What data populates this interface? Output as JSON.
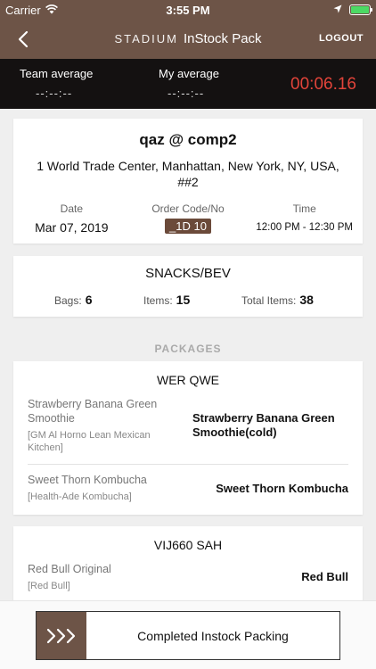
{
  "status_bar": {
    "carrier": "Carrier",
    "time": "3:55 PM"
  },
  "nav": {
    "brand": "STADIUM",
    "title": "InStock Pack",
    "logout_label": "LOGOUT"
  },
  "timers": {
    "team_label": "Team average",
    "team_value": "--:--:--",
    "my_label": "My average",
    "my_value": "--:--:--",
    "elapsed": "00:06.16",
    "elapsed_color": "#e2443a"
  },
  "order": {
    "title": "qaz @ comp2",
    "address": "1 World Trade Center, Manhattan, New York, NY, USA, ##2",
    "date_label": "Date",
    "date_value": "Mar 07, 2019",
    "code_label": "Order Code/No",
    "code_value": "_1D 10",
    "time_label": "Time",
    "time_value": "12:00 PM - 12:30 PM"
  },
  "summary": {
    "title": "SNACKS/BEV",
    "bags_label": "Bags:",
    "bags_value": "6",
    "items_label": "Items:",
    "items_value": "15",
    "total_label": "Total Items:",
    "total_value": "38"
  },
  "packages_header": "PACKAGES",
  "packages": [
    {
      "name": "WER QWE",
      "items": [
        {
          "name": "Strawberry Banana Green Smoothie",
          "brand": "[GM Al Horno Lean Mexican Kitchen]",
          "display": "Strawberry Banana Green Smoothie(cold)"
        },
        {
          "name": "Sweet Thorn Kombucha",
          "brand": "[Health-Ade Kombucha]",
          "display": "Sweet Thorn Kombucha"
        }
      ]
    },
    {
      "name": "VIJ660 SAH",
      "items": [
        {
          "name": "Red Bull Original",
          "brand": "[Red Bull]",
          "display": "Red Bull"
        }
      ]
    }
  ],
  "complete_button": {
    "label": "Completed Instock Packing"
  },
  "colors": {
    "brand": "#6d5447",
    "timer_bg": "#141111",
    "badge": "#6b4a3a",
    "battery": "#4cd964"
  }
}
